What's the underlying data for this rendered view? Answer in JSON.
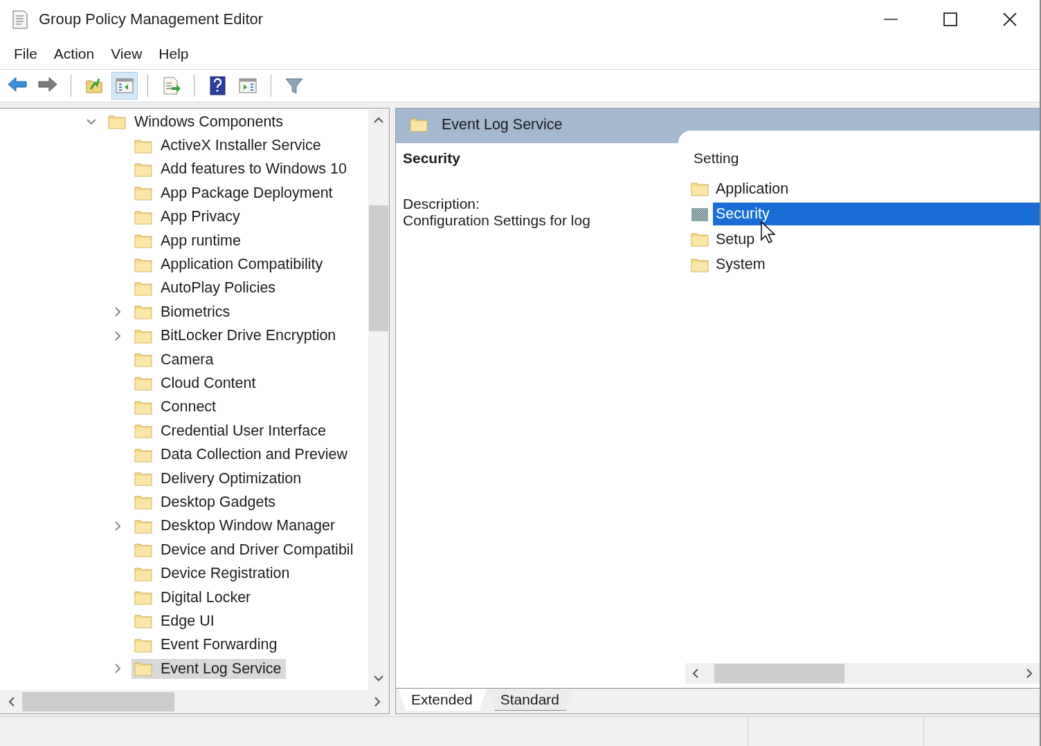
{
  "window": {
    "title": "Group Policy Management Editor"
  },
  "menu": [
    "File",
    "Action",
    "View",
    "Help"
  ],
  "toolbar": [
    [
      {
        "kind": "back",
        "pressed": false
      },
      {
        "kind": "forward",
        "pressed": false
      }
    ],
    [
      {
        "kind": "up",
        "pressed": false
      },
      {
        "kind": "tree",
        "pressed": true
      }
    ],
    [
      {
        "kind": "export",
        "pressed": false
      }
    ],
    [
      {
        "kind": "help",
        "pressed": false
      },
      {
        "kind": "action",
        "pressed": false
      }
    ],
    [
      {
        "kind": "filter",
        "pressed": false
      }
    ]
  ],
  "tree": {
    "items": [
      {
        "label": "Windows Components",
        "expanded": true,
        "selected": false,
        "children": [
          {
            "label": "ActiveX Installer Service",
            "expandable": false,
            "selected": false
          },
          {
            "label": "Add features to Windows 10",
            "expandable": false,
            "selected": false
          },
          {
            "label": "App Package Deployment",
            "expandable": false,
            "selected": false
          },
          {
            "label": "App Privacy",
            "expandable": false,
            "selected": false
          },
          {
            "label": "App runtime",
            "expandable": false,
            "selected": false
          },
          {
            "label": "Application Compatibility",
            "expandable": false,
            "selected": false
          },
          {
            "label": "AutoPlay Policies",
            "expandable": false,
            "selected": false
          },
          {
            "label": "Biometrics",
            "expandable": true,
            "selected": false
          },
          {
            "label": "BitLocker Drive Encryption",
            "expandable": true,
            "selected": false
          },
          {
            "label": "Camera",
            "expandable": false,
            "selected": false
          },
          {
            "label": "Cloud Content",
            "expandable": false,
            "selected": false
          },
          {
            "label": "Connect",
            "expandable": false,
            "selected": false
          },
          {
            "label": "Credential User Interface",
            "expandable": false,
            "selected": false
          },
          {
            "label": "Data Collection and Preview",
            "expandable": false,
            "selected": false
          },
          {
            "label": "Delivery Optimization",
            "expandable": false,
            "selected": false
          },
          {
            "label": "Desktop Gadgets",
            "expandable": false,
            "selected": false
          },
          {
            "label": "Desktop Window Manager",
            "expandable": true,
            "selected": false
          },
          {
            "label": "Device and Driver Compatibil",
            "expandable": false,
            "selected": false
          },
          {
            "label": "Device Registration",
            "expandable": false,
            "selected": false
          },
          {
            "label": "Digital Locker",
            "expandable": false,
            "selected": false
          },
          {
            "label": "Edge UI",
            "expandable": false,
            "selected": false
          },
          {
            "label": "Event Forwarding",
            "expandable": false,
            "selected": false
          },
          {
            "label": "Event Log Service",
            "expandable": true,
            "selected": true
          }
        ]
      }
    ]
  },
  "details": {
    "header": "Event Log Service",
    "title": "Security",
    "description_label": "Description:",
    "description": "Configuration Settings for log"
  },
  "settings": {
    "column": "Setting",
    "items": [
      {
        "label": "Application",
        "selected": false
      },
      {
        "label": "Security",
        "selected": true
      },
      {
        "label": "Setup",
        "selected": false
      },
      {
        "label": "System",
        "selected": false
      }
    ]
  },
  "view_tabs": [
    {
      "label": "Extended",
      "selected": true
    },
    {
      "label": "Standard",
      "selected": false
    }
  ]
}
